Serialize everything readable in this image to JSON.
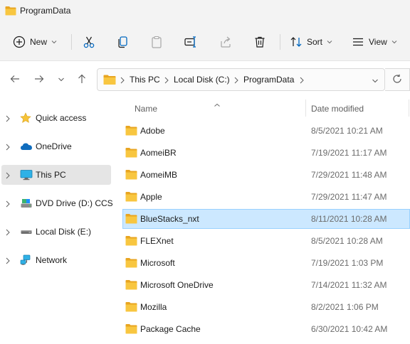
{
  "window": {
    "title": "ProgramData"
  },
  "toolbar": {
    "new_label": "New",
    "sort_label": "Sort",
    "view_label": "View"
  },
  "address": {
    "crumbs": [
      "This PC",
      "Local Disk (C:)",
      "ProgramData"
    ]
  },
  "sidebar": {
    "items": [
      {
        "label": "Quick access",
        "icon": "star-icon"
      },
      {
        "label": "OneDrive",
        "icon": "cloud-icon"
      },
      {
        "label": "This PC",
        "icon": "monitor-icon"
      },
      {
        "label": "DVD Drive (D:) CCSA",
        "icon": "dvd-drive-icon"
      },
      {
        "label": "Local Disk (E:)",
        "icon": "disk-drive-icon"
      },
      {
        "label": "Network",
        "icon": "network-icon"
      }
    ],
    "selected": "This PC"
  },
  "columns": {
    "name": "Name",
    "date": "Date modified"
  },
  "files": [
    {
      "name": "Adobe",
      "date": "8/5/2021 10:21 AM"
    },
    {
      "name": "AomeiBR",
      "date": "7/19/2021 11:17 AM"
    },
    {
      "name": "AomeiMB",
      "date": "7/29/2021 11:48 AM"
    },
    {
      "name": "Apple",
      "date": "7/29/2021 11:47 AM"
    },
    {
      "name": "BlueStacks_nxt",
      "date": "8/11/2021 10:28 AM"
    },
    {
      "name": "FLEXnet",
      "date": "8/5/2021 10:28 AM"
    },
    {
      "name": "Microsoft",
      "date": "7/19/2021 1:03 PM"
    },
    {
      "name": "Microsoft OneDrive",
      "date": "7/14/2021 11:32 AM"
    },
    {
      "name": "Mozilla",
      "date": "8/2/2021 1:06 PM"
    },
    {
      "name": "Package Cache",
      "date": "6/30/2021 10:42 AM"
    }
  ],
  "selected_file": "BlueStacks_nxt",
  "colors": {
    "folder": "#f8c640",
    "folder_dark": "#e8a521",
    "selection": "#cce8ff",
    "selection_border": "#99d1ff",
    "sidebar_selected": "#e5e5e5"
  }
}
